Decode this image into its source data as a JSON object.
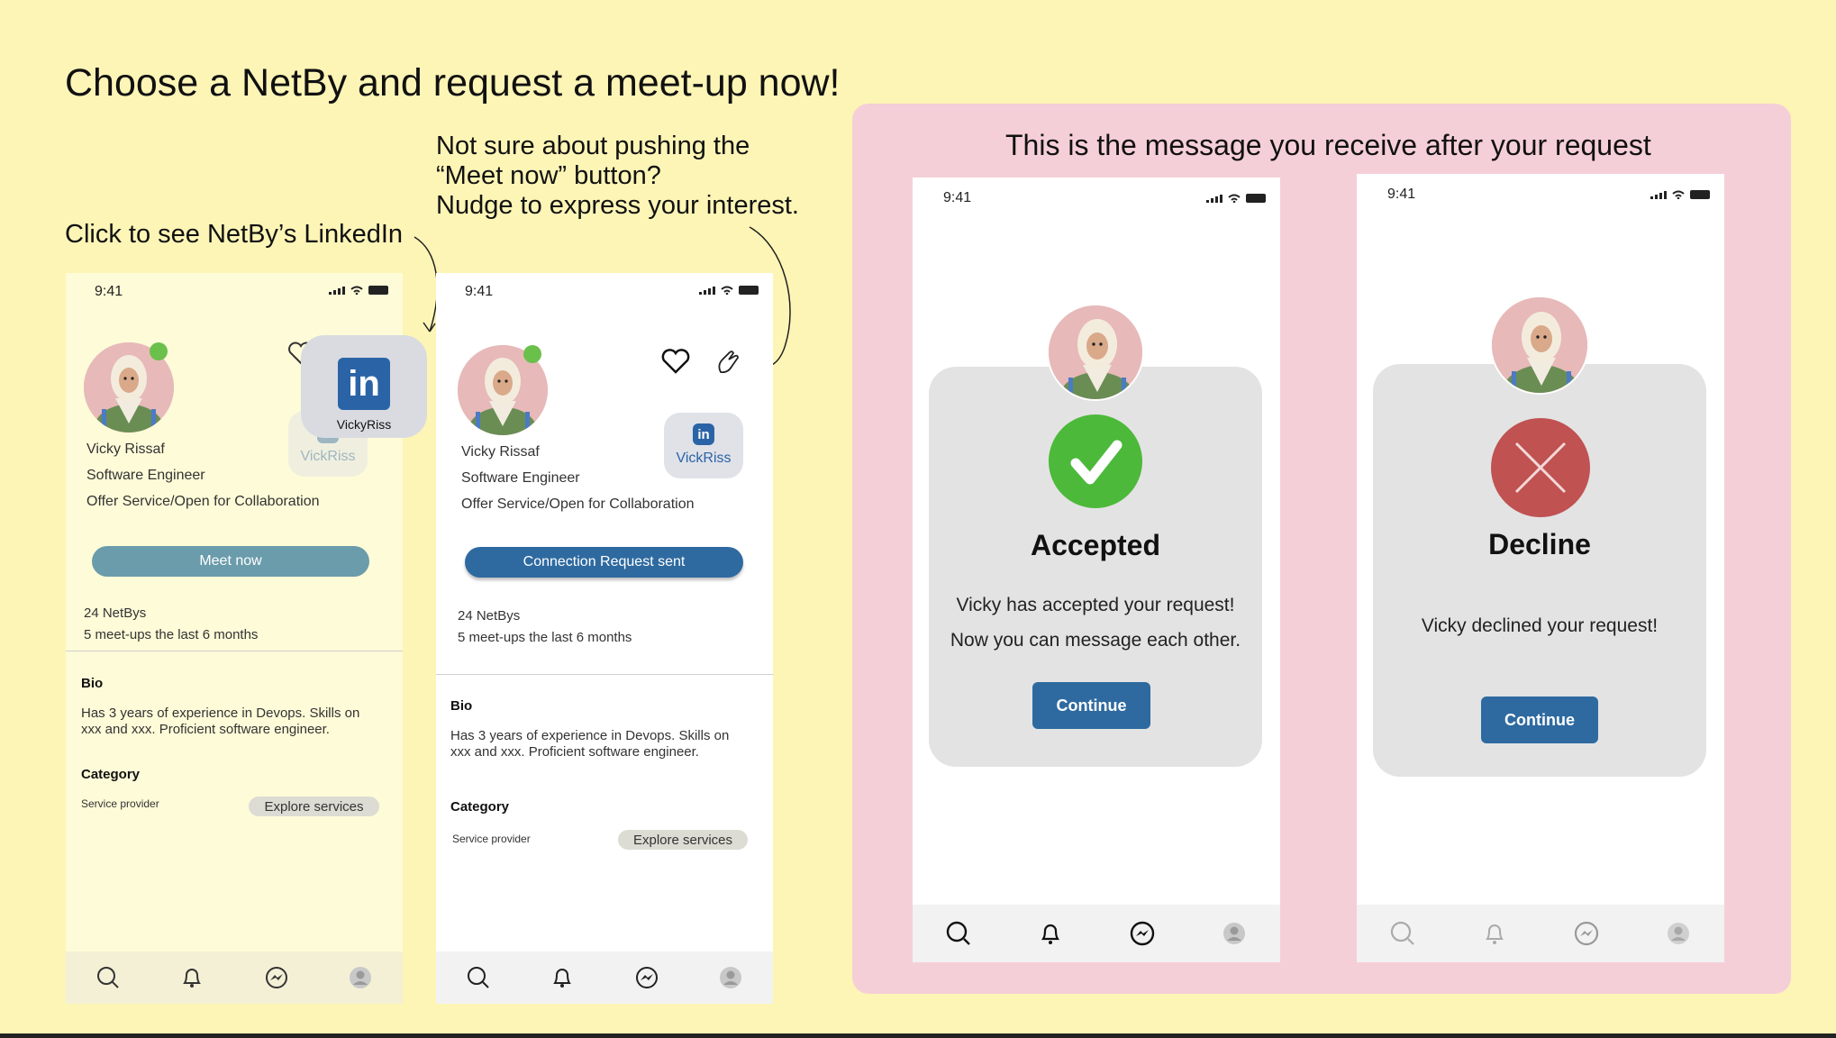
{
  "headline": "Choose a NetBy and request a meet-up now!",
  "notes": {
    "linkedin": "Click to see NetBy’s LinkedIn",
    "nudge_line1": "Not sure about pushing the",
    "nudge_line2": "“Meet now” button?",
    "nudge_line3": "Nudge to express your interest."
  },
  "status_time": "9:41",
  "profile": {
    "name": "Vicky Rissaf",
    "role": "Software Engineer",
    "offer": "Offer Service/Open for Collaboration",
    "linkedin_handle": "VickRiss",
    "linkedin_popup_handle": "VickyRiss",
    "netbys": "24 NetBys",
    "meetups": "5 meet-ups the last 6 months",
    "bio_heading": "Bio",
    "bio_text_line1": "Has 3 years of experience in Devops. Skills on",
    "bio_text_line2": "xxx and xxx. Proficient software engineer.",
    "category_heading": "Category",
    "category_value": "Service provider",
    "explore_label": "Explore services"
  },
  "buttons": {
    "meet_now": "Meet now",
    "request_sent": "Connection Request sent",
    "continue": "Continue"
  },
  "linkedin_glyph": "in",
  "result_panel": {
    "title": "This is the message you receive after your request",
    "accepted": {
      "title": "Accepted",
      "line1": "Vicky has accepted your request!",
      "line2": "Now you can message each other."
    },
    "declined": {
      "title": "Decline",
      "line1": "Vicky declined your request!"
    }
  },
  "nav_icons": [
    "search-icon",
    "bell-icon",
    "messenger-icon",
    "profile-icon"
  ],
  "colors": {
    "background": "#fdf5b6",
    "panel": "#f5cfd7",
    "primary_button": "#2e6aa0",
    "meet_now_button": "#6a9cab",
    "accepted": "#4cb93a",
    "declined": "#c05252",
    "online": "#6bc04b",
    "linkedin": "#2b64a6"
  }
}
